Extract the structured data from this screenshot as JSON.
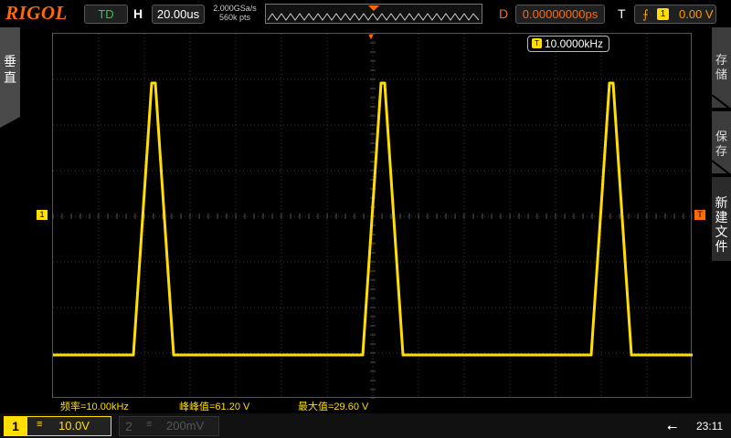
{
  "brand": "RIGOL",
  "status": "TD",
  "timebase": {
    "label": "H",
    "value": "20.00us"
  },
  "sample": {
    "rate": "2.000GSa/s",
    "depth": "560k pts"
  },
  "delay": {
    "label": "D",
    "value": "0.00000000ps"
  },
  "trigger": {
    "label": "T",
    "source": "1",
    "level": "0.00 V"
  },
  "left_menu": {
    "label": "垂\n直"
  },
  "right_menu": {
    "item1": "存\n储",
    "item2": "保\n存",
    "item3": "新\n建\n文\n件"
  },
  "freq_counter": {
    "value": "10.0000kHz"
  },
  "measurements": [
    {
      "text": "频率=10.00kHz"
    },
    {
      "text": "峰峰值=61.20 V"
    },
    {
      "text": "最大值=29.60 V"
    }
  ],
  "channels": {
    "ch1": {
      "num": "1",
      "coupling": "≡",
      "scale": "10.0V"
    },
    "ch2": {
      "num": "2",
      "coupling": "≡",
      "scale": "200mV"
    }
  },
  "clock": "23:11",
  "colors": {
    "ch1": "#ffde00",
    "trigger": "#ff6a00"
  },
  "marker_ch1": "1",
  "marker_trig": "T"
}
